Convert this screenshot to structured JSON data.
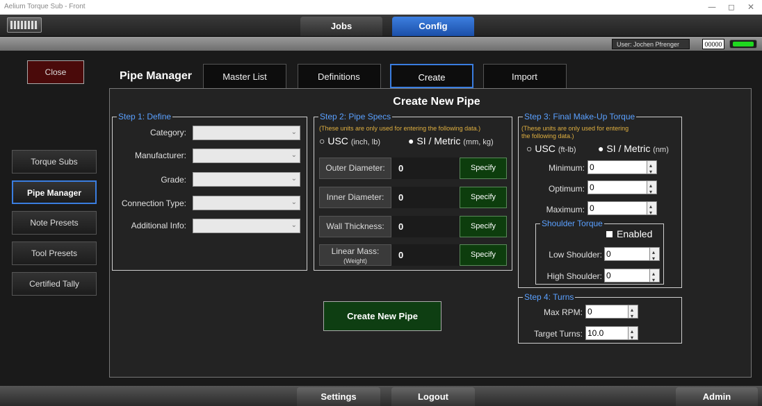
{
  "window": {
    "title": "Aelium Torque Sub - Front",
    "minimize": "—",
    "restore": "◻",
    "close": "✕"
  },
  "top_tabs": {
    "jobs": "Jobs",
    "config": "Config"
  },
  "userbar": {
    "user": "User: Jochen Pfrenger",
    "code": "00000"
  },
  "sidebar": {
    "close": "Close",
    "items": [
      "Torque Subs",
      "Pipe Manager",
      "Note Presets",
      "Tool Presets",
      "Certified Tally"
    ],
    "active_index": 1
  },
  "header": {
    "title": "Pipe Manager",
    "tabs": [
      "Master List",
      "Definitions",
      "Create",
      "Import"
    ],
    "active_tab": "Create"
  },
  "panel_title": "Create New Pipe",
  "step1": {
    "legend": "Step 1: Define",
    "fields": [
      {
        "label": "Category:",
        "value": ""
      },
      {
        "label": "Manufacturer:",
        "value": ""
      },
      {
        "label": "Grade:",
        "value": ""
      },
      {
        "label": "Connection Type:",
        "value": ""
      },
      {
        "label": "Additional Info:",
        "value": ""
      }
    ]
  },
  "step2": {
    "legend": "Step 2: Pipe Specs",
    "note": "(These units are only used for entering the following data.)",
    "usc_label": "USC",
    "usc_unit": "(inch, lb)",
    "si_label": "SI / Metric",
    "si_unit": "(mm, kg)",
    "selected_unit": "SI / Metric",
    "rows": [
      {
        "label": "Outer Diameter:",
        "value": "0",
        "button": "Specify"
      },
      {
        "label": "Inner Diameter:",
        "value": "0",
        "button": "Specify"
      },
      {
        "label": "Wall Thickness:",
        "value": "0",
        "button": "Specify"
      },
      {
        "label": "Linear Mass:",
        "sublabel": "(Weight)",
        "value": "0",
        "button": "Specify"
      }
    ]
  },
  "step3": {
    "legend": "Step 3: Final Make-Up Torque",
    "note_line1": "(These units are only used for entering",
    "note_line2": "the following data.)",
    "usc_label": "USC",
    "usc_unit": "(ft-lb)",
    "si_label": "SI / Metric",
    "si_unit": "(nm)",
    "selected_unit": "SI / Metric",
    "minimum": {
      "label": "Minimum:",
      "value": "0"
    },
    "optimum": {
      "label": "Optimum:",
      "value": "0"
    },
    "maximum": {
      "label": "Maximum:",
      "value": "0"
    },
    "shoulder": {
      "legend": "Shoulder Torque",
      "enabled_label": "Enabled",
      "enabled": true,
      "low": {
        "label": "Low Shoulder:",
        "value": "0"
      },
      "high": {
        "label": "High Shoulder:",
        "value": "0"
      }
    }
  },
  "step4": {
    "legend": "Step 4: Turns",
    "max_rpm": {
      "label": "Max RPM:",
      "value": "0"
    },
    "target_turns": {
      "label": "Target Turns:",
      "value": "10.0"
    }
  },
  "create_button": "Create New Pipe",
  "bottom": {
    "settings": "Settings",
    "logout": "Logout",
    "admin": "Admin"
  },
  "colors": {
    "accent": "#3a7de0",
    "legend": "#5aa0ff",
    "note": "#e0b040",
    "ok_green": "#1fd81f",
    "close_red": "#4a0a0a",
    "button_green": "#0e3e12"
  }
}
